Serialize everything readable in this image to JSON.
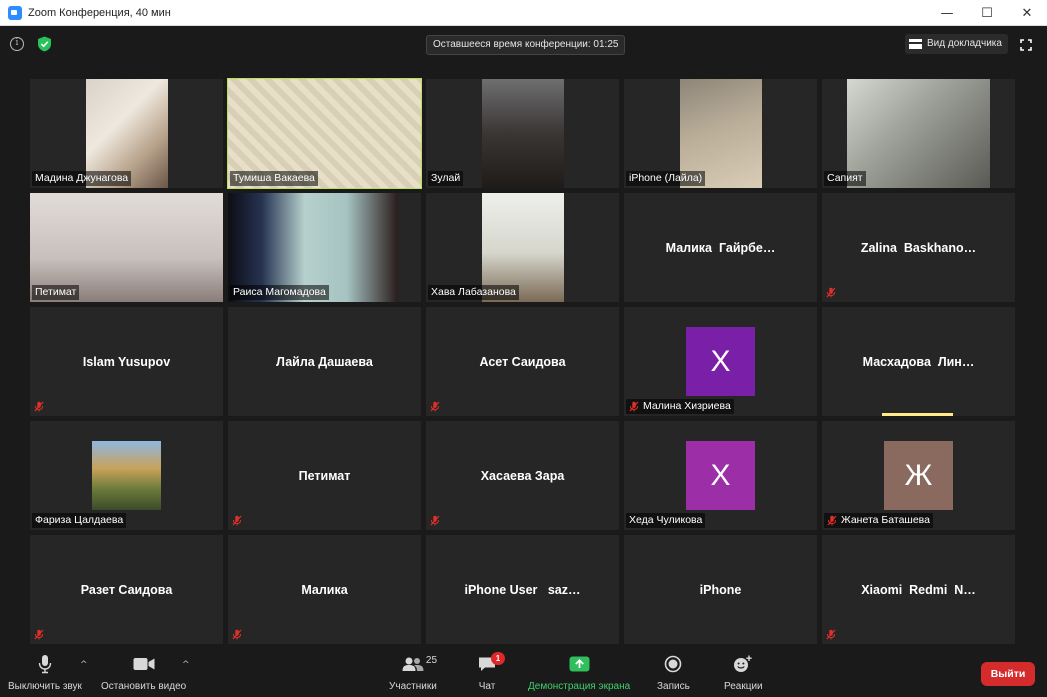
{
  "window": {
    "title": "Zoom Конференция, 40 мин",
    "minimize": "—",
    "maximize": "☐",
    "close": "✕"
  },
  "topbar": {
    "timer": "Оставшееся время конференции: 01:25",
    "speaker_view": "Вид докладчика"
  },
  "participants": [
    {
      "name": "Мадина Джунагова",
      "type": "video"
    },
    {
      "name": "Тумиша Вакаева",
      "type": "video",
      "active": true
    },
    {
      "name": "Зулай",
      "type": "video"
    },
    {
      "name": "iPhone (Лайла)",
      "type": "video"
    },
    {
      "name": "Сапият",
      "type": "video"
    },
    {
      "name": "Петимат",
      "type": "video"
    },
    {
      "name": "Раиса Магомадова",
      "type": "video"
    },
    {
      "name": "Хава Лабазанова",
      "type": "video"
    },
    {
      "name": "Малика  Гайрбе…",
      "type": "name",
      "muted": false
    },
    {
      "name": "Zalina  Baskhano…",
      "type": "name",
      "muted": true
    },
    {
      "name": "Islam Yusupov",
      "type": "name",
      "muted": true
    },
    {
      "name": "Лайла Дашаева",
      "type": "name",
      "muted": false
    },
    {
      "name": "Асет Саидова",
      "type": "name",
      "muted": true
    },
    {
      "name": "Малина Хизриева",
      "type": "avatar",
      "letter": "X",
      "color": "#7a1fa8",
      "muted": true
    },
    {
      "name": "Масхадова  Лин…",
      "type": "name",
      "muted": false,
      "speaking": true
    },
    {
      "name": "Фариза Цалдаева",
      "type": "photo"
    },
    {
      "name": "Петимат",
      "type": "name",
      "muted": true
    },
    {
      "name": "Хасаева Зара",
      "type": "name",
      "muted": true
    },
    {
      "name": "Хеда Чуликова",
      "type": "avatar",
      "letter": "X",
      "color": "#9c2ea8",
      "muted": false
    },
    {
      "name": "Жанета Баташева",
      "type": "avatar",
      "letter": "Ж",
      "color": "#8a6a5e",
      "muted": true
    },
    {
      "name": "Разет Саидова",
      "type": "name",
      "muted": true
    },
    {
      "name": "Малика",
      "type": "name",
      "muted": true
    },
    {
      "name": "iPhone User   saz…",
      "type": "name",
      "muted": false
    },
    {
      "name": "iPhone",
      "type": "name",
      "muted": false
    },
    {
      "name": "Xiaomi  Redmi  N…",
      "type": "name",
      "muted": true
    }
  ],
  "toolbar": {
    "mute": "Выключить звук",
    "video": "Остановить видео",
    "participants": "Участники",
    "participants_count": "25",
    "chat": "Чат",
    "chat_badge": "1",
    "share": "Демонстрация экрана",
    "record": "Запись",
    "reactions": "Реакции",
    "leave": "Выйти"
  },
  "colors": {
    "accent_share": "#3fcf6b",
    "leave": "#d42c2c",
    "active_speaker": "#b6e35a"
  }
}
